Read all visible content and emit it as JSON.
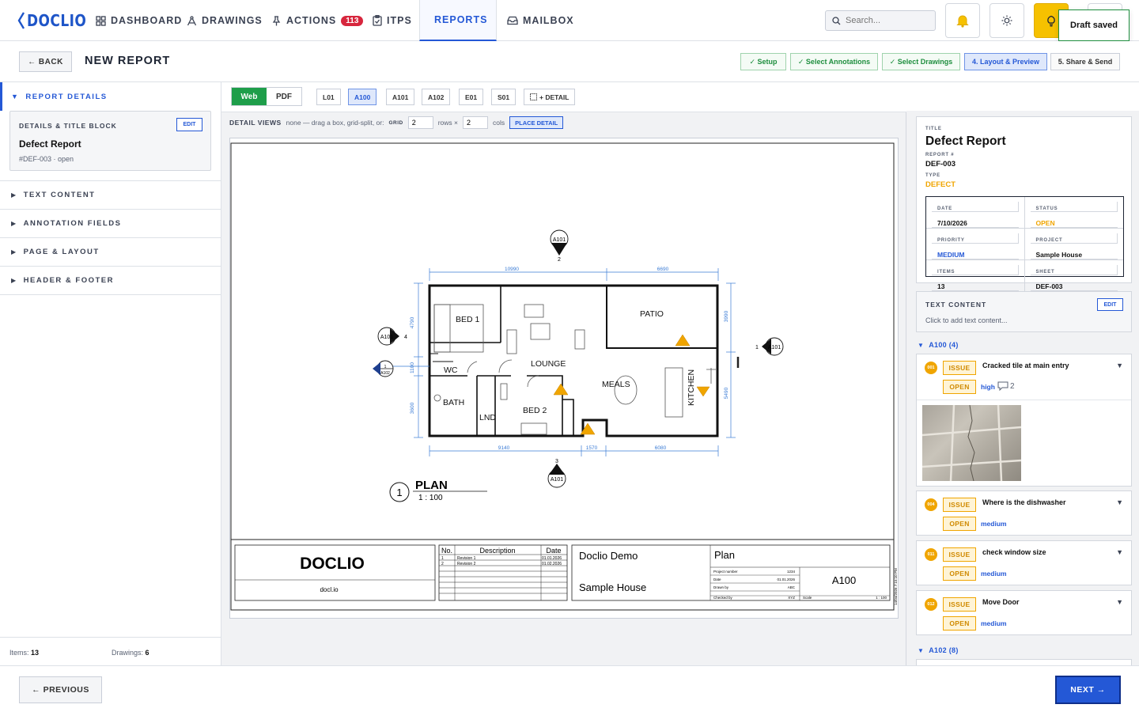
{
  "brand": {
    "name": "DOCLIO",
    "accent": "#2458d6"
  },
  "nav": {
    "items": [
      {
        "label": "DASHBOARD",
        "icon": "grid-icon"
      },
      {
        "label": "DRAWINGS",
        "icon": "compass-icon"
      },
      {
        "label": "ACTIONS",
        "icon": "pin-icon",
        "badge": "113"
      },
      {
        "label": "ITPS",
        "icon": "clipboard-check-icon"
      },
      {
        "label": "REPORTS",
        "icon": "report-icon",
        "active": true
      },
      {
        "label": "MAILBOX",
        "icon": "inbox-icon"
      }
    ],
    "search_placeholder": "Search...",
    "toast": "Draft saved"
  },
  "subheader": {
    "back_label": "← BACK",
    "title": "NEW REPORT",
    "steps": [
      {
        "label": "✓ Setup",
        "state": "done"
      },
      {
        "label": "✓ Select Annotations",
        "state": "done"
      },
      {
        "label": "✓ Select Drawings",
        "state": "done"
      },
      {
        "label": "4. Layout & Preview",
        "state": "active"
      },
      {
        "label": "5. Share & Send",
        "state": "todo"
      }
    ]
  },
  "left": {
    "sections": [
      "REPORT DETAILS",
      "TEXT CONTENT",
      "ANNOTATION FIELDS",
      "PAGE & LAYOUT",
      "HEADER & FOOTER"
    ],
    "details_card": {
      "label": "DETAILS & TITLE BLOCK",
      "edit": "EDIT",
      "title": "Defect Report",
      "sub": "#DEF-003 · open"
    },
    "footer": {
      "items_label": "Items:",
      "items_value": "13",
      "drawings_label": "Drawings:",
      "drawings_value": "6"
    }
  },
  "center": {
    "view_modes": [
      "Web",
      "PDF"
    ],
    "sheets": [
      "L01",
      "A100",
      "A101",
      "A102",
      "E01",
      "S01"
    ],
    "active_sheet": "A100",
    "detail_button": "+ DETAIL",
    "detail_views": {
      "label": "DETAIL VIEWS",
      "hint": "none — drag a box, grid-split, or:",
      "grid_label": "GRID",
      "rows_value": "2",
      "rows_label": "rows ×",
      "cols_value": "2",
      "cols_label": "cols",
      "place_label": "PLACE DETAIL"
    }
  },
  "drawing": {
    "rooms": [
      "BED 1",
      "LOUNGE",
      "PATIO",
      "WC",
      "BATH",
      "LND",
      "BED 2",
      "MEALS",
      "KITCHEN"
    ],
    "dims_top": [
      "10990",
      "6690"
    ],
    "dims_bottom": [
      "9140",
      "1570",
      "6080"
    ],
    "dims_left": [
      "4790",
      "1100",
      "3600"
    ],
    "dims_right": [
      "3990",
      "5490"
    ],
    "markers": {
      "sheet": "A101",
      "n1": "1",
      "n2": "2",
      "n3": "3",
      "n4": "4"
    },
    "section_tag_small": "A102",
    "plan_number": "1",
    "plan_title": "PLAN",
    "plan_scale": "1 : 100",
    "title_block": {
      "company": "DOCLIO",
      "website": "docl.io",
      "rev_headers": [
        "No.",
        "Description",
        "Date"
      ],
      "revisions": [
        {
          "no": "1",
          "desc": "Revision 1",
          "date": "01.01.2026"
        },
        {
          "no": "2",
          "desc": "Revision 2",
          "date": "01.02.2026"
        }
      ],
      "client": "Doclio Demo",
      "project": "Sample House",
      "sheet_title": "Plan",
      "fields": [
        {
          "label": "Project number",
          "value": "1234"
        },
        {
          "label": "Date",
          "value": "01.01.2026"
        },
        {
          "label": "Drawn by",
          "value": "ABC"
        },
        {
          "label": "Checked by",
          "value": "XYZ"
        }
      ],
      "scale_label": "Scale",
      "scale_value": "1 : 100",
      "sheet_number": "A100",
      "timestamp": "14/04/2026 7:15:10 PM"
    }
  },
  "right": {
    "title_label": "TITLE",
    "title": "Defect Report",
    "report_no_label": "REPORT #",
    "report_no": "DEF-003",
    "type_label": "TYPE",
    "type": "DEFECT",
    "meta": [
      {
        "label": "DATE",
        "value": "7/10/2026",
        "color": "#111"
      },
      {
        "label": "STATUS",
        "value": "OPEN",
        "color": "#f0a500"
      },
      {
        "label": "PRIORITY",
        "value": "MEDIUM",
        "color": "#2458d6"
      },
      {
        "label": "PROJECT",
        "value": "Sample House",
        "color": "#111"
      },
      {
        "label": "ITEMS",
        "value": "13",
        "color": "#111"
      },
      {
        "label": "SHEET",
        "value": "DEF-003",
        "color": "#111"
      }
    ],
    "text_content": {
      "label": "TEXT CONTENT",
      "edit": "EDIT",
      "placeholder": "Click to add text content..."
    },
    "group1": "A100 (4)",
    "group2": "A102 (8)",
    "items": [
      {
        "num": "001",
        "type": "ISSUE",
        "status": "OPEN",
        "title": "Cracked tile at main entry",
        "priority": "high",
        "comments": "2"
      },
      {
        "num": "004",
        "type": "ISSUE",
        "status": "OPEN",
        "title": "Where is the dishwasher",
        "priority": "medium"
      },
      {
        "num": "011",
        "type": "ISSUE",
        "status": "OPEN",
        "title": "check window size",
        "priority": "medium"
      },
      {
        "num": "012",
        "type": "ISSUE",
        "status": "OPEN",
        "title": "Move Door",
        "priority": "medium"
      }
    ]
  },
  "footer": {
    "prev": "← PREVIOUS",
    "next": "NEXT →"
  }
}
